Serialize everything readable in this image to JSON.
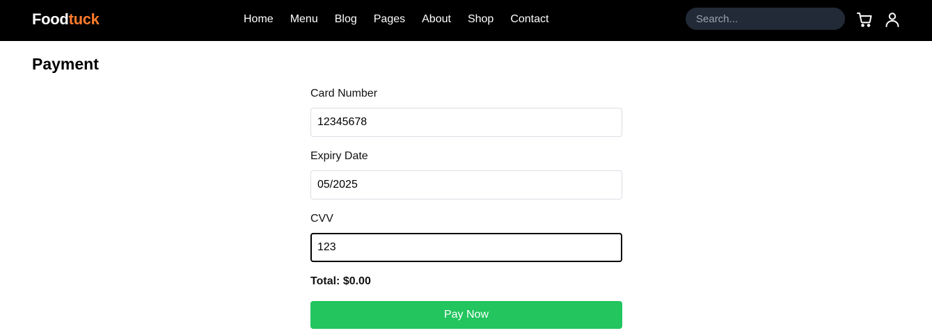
{
  "header": {
    "logo_part1": "Food",
    "logo_part2": "tuck",
    "nav": [
      "Home",
      "Menu",
      "Blog",
      "Pages",
      "About",
      "Shop",
      "Contact"
    ],
    "search_placeholder": "Search...",
    "cart_icon": "shopping-cart-icon",
    "user_icon": "user-icon"
  },
  "page": {
    "title": "Payment"
  },
  "form": {
    "card_number_label": "Card Number",
    "card_number_value": "12345678",
    "expiry_label": "Expiry Date",
    "expiry_value": "05/2025",
    "cvv_label": "CVV",
    "cvv_value": "123",
    "total_label": "Total:",
    "total_value": "$0.00",
    "pay_label": "Pay Now"
  },
  "colors": {
    "nav_background": "#000000",
    "logo_accent": "#ff7b2c",
    "search_background": "#222a38",
    "pay_button": "#22c55e"
  }
}
